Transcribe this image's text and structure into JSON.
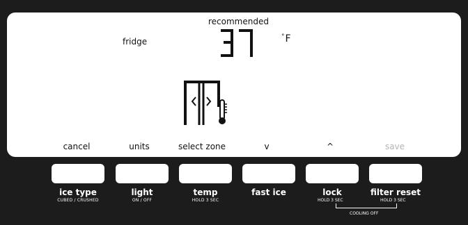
{
  "display": {
    "recommended_label": "recommended",
    "zone_label": "fridge",
    "temperature": "37",
    "unit_degree": "°",
    "unit_letter": "F"
  },
  "softkeys": [
    "cancel",
    "units",
    "select zone",
    "v",
    "^",
    "save"
  ],
  "buttons": [
    {
      "label": "ice type",
      "sub": "CUBED / CRUSHED"
    },
    {
      "label": "light",
      "sub": "ON / OFF"
    },
    {
      "label": "temp",
      "sub": "HOLD 3 SEC"
    },
    {
      "label": "fast ice",
      "sub": ""
    },
    {
      "label": "lock",
      "sub": "HOLD 3 SEC"
    },
    {
      "label": "filter reset",
      "sub": "HOLD 3 SEC"
    }
  ],
  "cooling_off_label": "COOLING OFF",
  "colors": {
    "panel": "#1c1c1c",
    "screen": "#ffffff",
    "disabled_text": "#b5b5b5"
  }
}
